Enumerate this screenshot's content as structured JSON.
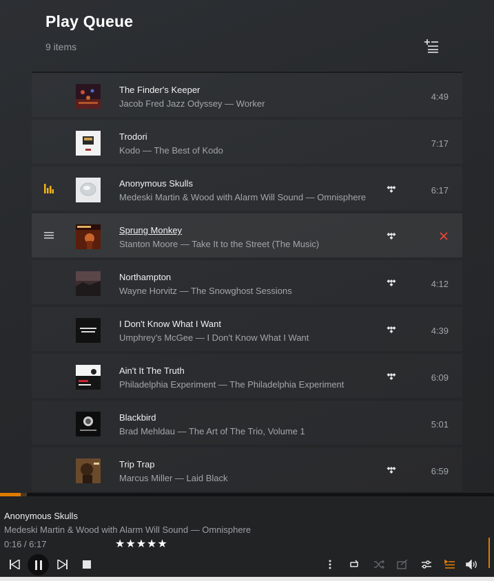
{
  "header": {
    "title": "Play Queue",
    "count": "9 items",
    "queue_options_icon": "playlist-add-icon"
  },
  "queue": [
    {
      "title": "The Finder's Keeper",
      "subtitle": "Jacob Fred Jazz Odyssey — Worker",
      "duration": "4:49",
      "tidal": false,
      "state": "normal"
    },
    {
      "title": "Trodori",
      "subtitle": "Kodo — The Best of Kodo",
      "duration": "7:17",
      "tidal": false,
      "state": "normal"
    },
    {
      "title": "Anonymous Skulls",
      "subtitle": "Medeski Martin & Wood with Alarm Will Sound — Omnisphere",
      "duration": "6:17",
      "tidal": true,
      "state": "playing"
    },
    {
      "title": "Sprung Monkey",
      "subtitle": "Stanton Moore — Take It to the Street (The Music)",
      "duration": "",
      "tidal": true,
      "state": "hovered"
    },
    {
      "title": "Northampton",
      "subtitle": "Wayne Horvitz — The Snowghost Sessions",
      "duration": "4:12",
      "tidal": true,
      "state": "normal"
    },
    {
      "title": "I Don't Know What I Want",
      "subtitle": "Umphrey's McGee — I Don't Know What I Want",
      "duration": "4:39",
      "tidal": true,
      "state": "normal"
    },
    {
      "title": "Ain't It The Truth",
      "subtitle": "Philadelphia Experiment — The Philadelphia Experiment",
      "duration": "6:09",
      "tidal": true,
      "state": "normal"
    },
    {
      "title": "Blackbird",
      "subtitle": "Brad Mehldau — The Art of The Trio, Volume 1",
      "duration": "5:01",
      "tidal": false,
      "state": "normal"
    },
    {
      "title": "Trip Trap",
      "subtitle": "Marcus Miller — Laid Black",
      "duration": "6:59",
      "tidal": true,
      "state": "normal"
    }
  ],
  "player": {
    "title": "Anonymous Skulls",
    "subtitle": "Medeski Martin & Wood with Alarm Will Sound — Omnisphere",
    "time": "0:16 / 6:17",
    "rating_stars": "★★★★★",
    "rating": 5,
    "progress": 0.0425,
    "buffered": 0.055
  },
  "colors": {
    "accent": "#e07b00",
    "playing_indicator": "#f2b318",
    "remove": "#e8473b",
    "background": "#27292c"
  }
}
